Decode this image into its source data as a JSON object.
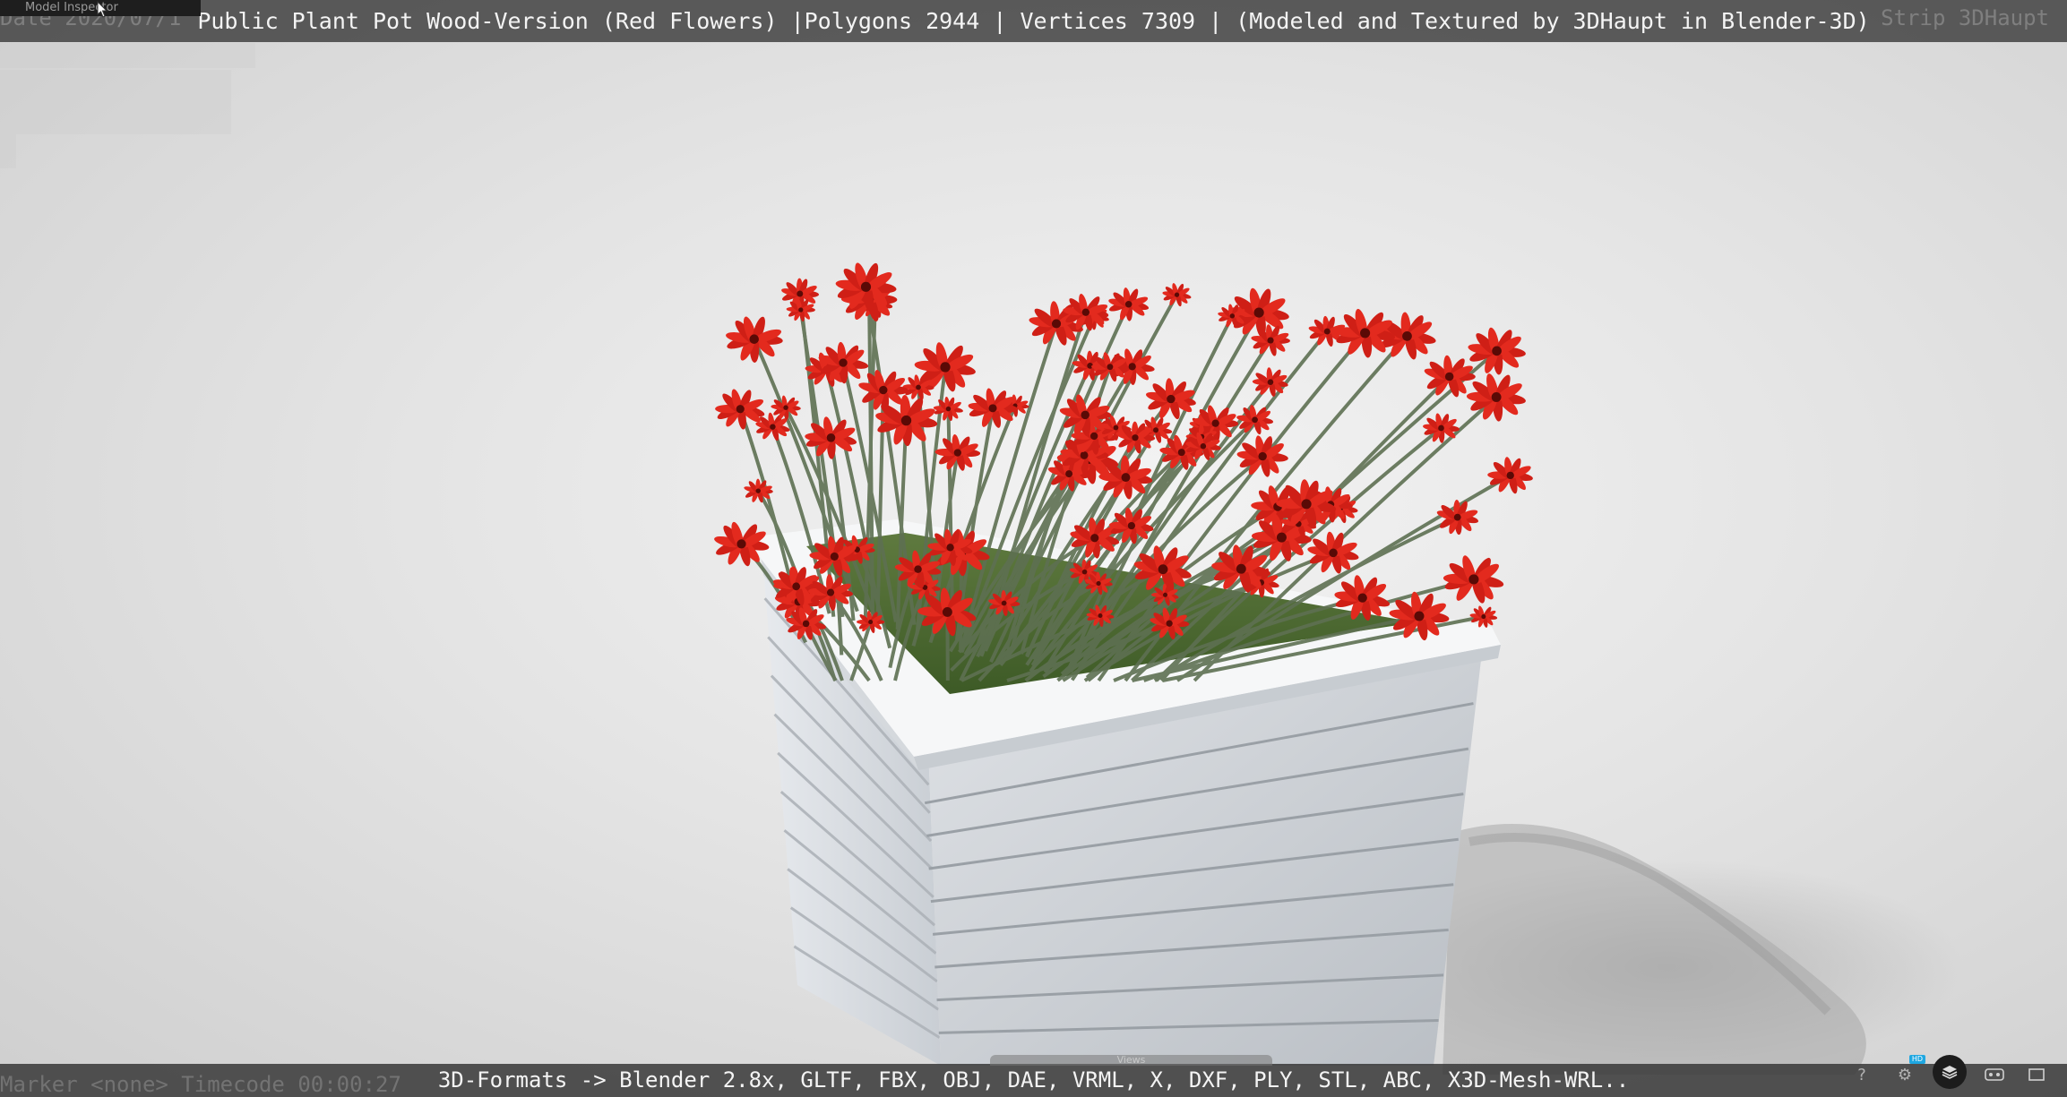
{
  "header": {
    "caption": "Public Plant Pot Wood-Version (Red Flowers) |Polygons 2944 | Vertices 7309 | (Modeled and Textured by 3DHaupt in Blender-3D)",
    "inspector_tab_label": "Model Inspector",
    "ghost_left": "Date 2020/07/1",
    "ghost_right": "Strip 3DHaupt"
  },
  "footer": {
    "caption": "3D-Formats -> Blender 2.8x, GLTF, FBX, OBJ, DAE, VRML, X, DXF, PLY, STL, ABC, X3D-Mesh-WRL..",
    "ghost_left": "Marker <none>  Timecode 00:00:27",
    "views_label": "Views"
  },
  "controls": {
    "help_icon": "help-icon",
    "settings_icon": "gear-icon",
    "hd_badge": "HD",
    "layers_icon": "layers-icon",
    "vr_icon": "vr-headset-icon",
    "fullscreen_icon": "fullscreen-icon"
  },
  "colors": {
    "bar_background": "#3c3c3c",
    "caption_text": "#f4f4f4",
    "flower_red": "#e0231b",
    "pot_white": "#eceff1",
    "accent_blue": "#1ea7e1"
  }
}
